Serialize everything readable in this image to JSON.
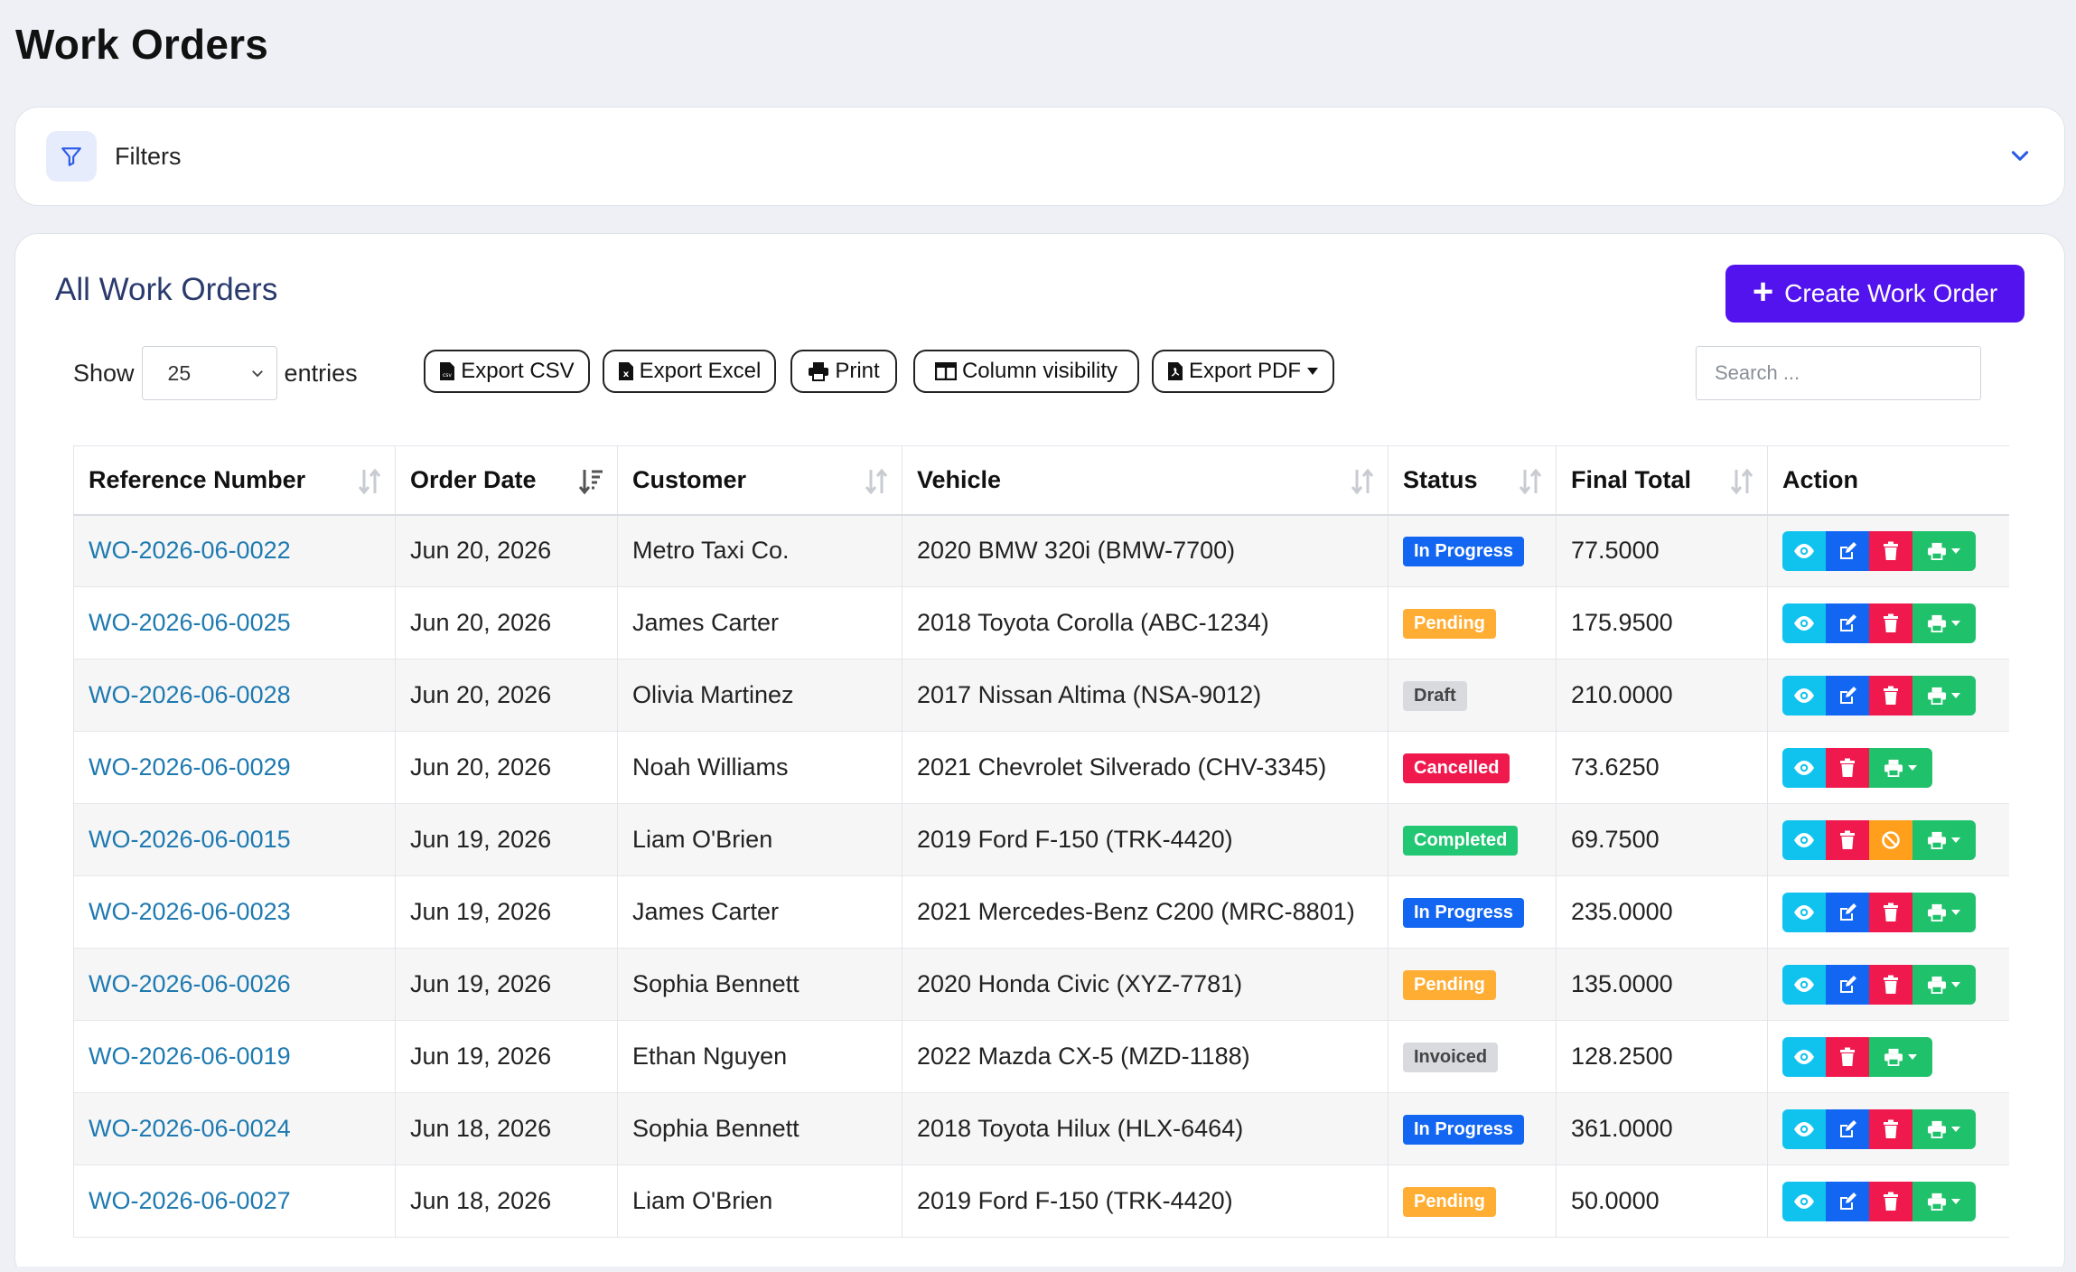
{
  "page": {
    "title": "Work Orders"
  },
  "filters": {
    "label": "Filters"
  },
  "card": {
    "title": "All Work Orders",
    "create_label": "Create Work Order"
  },
  "length": {
    "show_label": "Show",
    "value": "25",
    "entries_label": "entries"
  },
  "toolbar": {
    "export_csv": "Export CSV",
    "export_excel": "Export Excel",
    "print": "Print",
    "column_visibility": "Column visibility",
    "export_pdf": "Export PDF"
  },
  "search": {
    "placeholder": "Search ..."
  },
  "table": {
    "headers": {
      "reference": "Reference Number",
      "order_date": "Order Date",
      "customer": "Customer",
      "vehicle": "Vehicle",
      "status": "Status",
      "final_total": "Final Total",
      "action": "Action"
    },
    "rows": [
      {
        "reference": "WO-2026-06-0022",
        "date": "Jun 20, 2026",
        "customer": "Metro Taxi Co.",
        "vehicle": "2020 BMW 320i (BMW-7700)",
        "status": "In Progress",
        "total": "77.5000"
      },
      {
        "reference": "WO-2026-06-0025",
        "date": "Jun 20, 2026",
        "customer": "James Carter",
        "vehicle": "2018 Toyota Corolla (ABC-1234)",
        "status": "Pending",
        "total": "175.9500"
      },
      {
        "reference": "WO-2026-06-0028",
        "date": "Jun 20, 2026",
        "customer": "Olivia Martinez",
        "vehicle": "2017 Nissan Altima (NSA-9012)",
        "status": "Draft",
        "total": "210.0000"
      },
      {
        "reference": "WO-2026-06-0029",
        "date": "Jun 20, 2026",
        "customer": "Noah Williams",
        "vehicle": "2021 Chevrolet Silverado (CHV-3345)",
        "status": "Cancelled",
        "total": "73.6250"
      },
      {
        "reference": "WO-2026-06-0015",
        "date": "Jun 19, 2026",
        "customer": "Liam O'Brien",
        "vehicle": "2019 Ford F-150 (TRK-4420)",
        "status": "Completed",
        "total": "69.7500"
      },
      {
        "reference": "WO-2026-06-0023",
        "date": "Jun 19, 2026",
        "customer": "James Carter",
        "vehicle": "2021 Mercedes-Benz C200 (MRC-8801)",
        "status": "In Progress",
        "total": "235.0000"
      },
      {
        "reference": "WO-2026-06-0026",
        "date": "Jun 19, 2026",
        "customer": "Sophia Bennett",
        "vehicle": "2020 Honda Civic (XYZ-7781)",
        "status": "Pending",
        "total": "135.0000"
      },
      {
        "reference": "WO-2026-06-0019",
        "date": "Jun 19, 2026",
        "customer": "Ethan Nguyen",
        "vehicle": "2022 Mazda CX-5 (MZD-1188)",
        "status": "Invoiced",
        "total": "128.2500"
      },
      {
        "reference": "WO-2026-06-0024",
        "date": "Jun 18, 2026",
        "customer": "Sophia Bennett",
        "vehicle": "2018 Toyota Hilux (HLX-6464)",
        "status": "In Progress",
        "total": "361.0000"
      },
      {
        "reference": "WO-2026-06-0027",
        "date": "Jun 18, 2026",
        "customer": "Liam O'Brien",
        "vehicle": "2019 Ford F-150 (TRK-4420)",
        "status": "Pending",
        "total": "50.0000"
      }
    ]
  },
  "status_colors": {
    "In Progress": "#1266f1",
    "Pending": "#ffad33",
    "Draft": "#d8dade",
    "Cancelled": "#f0194e",
    "Completed": "#22c774",
    "Invoiced": "#d8dade"
  },
  "action_icons": [
    "eye-icon",
    "edit-icon",
    "trash-icon",
    "ban-icon",
    "printer-icon"
  ]
}
